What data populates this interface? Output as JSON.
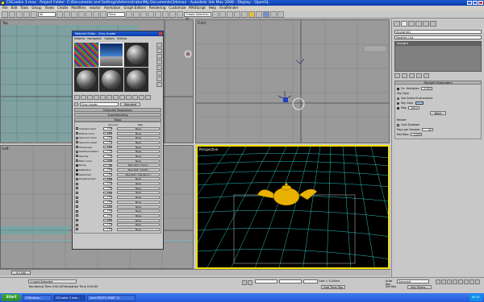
{
  "window": {
    "title": "CSCookie 3.max - Project Folder: C:\\Documents and Settings\\Administrator\\My Documents\\3dsmax - Autodesk 3ds Max 2008 - Display : OpenGL"
  },
  "menubar": [
    "File",
    "Edit",
    "Tools",
    "Group",
    "Views",
    "Create",
    "Modifiers",
    "reactor",
    "Animation",
    "Graph Editors",
    "Rendering",
    "Customize",
    "MAXScript",
    "Help",
    "FinalRender"
  ],
  "toolbar": {
    "selection_set": "All",
    "view_select": "View",
    "named_set": "Create Selection Se"
  },
  "viewports": {
    "top": "Top",
    "front": "Front",
    "left": "Left",
    "perspective": "Perspective"
  },
  "material_editor": {
    "title": "Material Editor - Grey shader",
    "menu": [
      "Material",
      "Navigation",
      "Options",
      "Utilities"
    ],
    "material_name": "Grey shader",
    "material_type": "Standard",
    "rollouts": [
      "Extended Parameters",
      "SuperSampling",
      "Maps"
    ],
    "columns": {
      "amount": "Amount",
      "map": "Map"
    },
    "maps": [
      {
        "name": "Ambient Color",
        "amount": "100",
        "map": "None",
        "on": false
      },
      {
        "name": "Diffuse Color",
        "amount": "100",
        "map": "None",
        "on": false
      },
      {
        "name": "Specular Color",
        "amount": "100",
        "map": "None",
        "on": false
      },
      {
        "name": "Specular Level",
        "amount": "100",
        "map": "None",
        "on": false
      },
      {
        "name": "Glossiness",
        "amount": "100",
        "map": "None",
        "on": false
      },
      {
        "name": "Self-Illumination",
        "amount": "100",
        "map": "None",
        "on": false
      },
      {
        "name": "Opacity",
        "amount": "100",
        "map": "None",
        "on": false
      },
      {
        "name": "Filter Color",
        "amount": "100",
        "map": "None",
        "on": false
      },
      {
        "name": "Bump",
        "amount": "30",
        "map": "Map #24 ( Hnoit )",
        "on": true
      },
      {
        "name": "Reflection",
        "amount": "100",
        "map": "Map #18 ( Falloff )",
        "on": true
      },
      {
        "name": "Refraction",
        "amount": "100",
        "map": "Map #23 ( Flat Mirror )",
        "on": true
      },
      {
        "name": "Displacement",
        "amount": "100",
        "map": "None",
        "on": false
      },
      {
        "name": "",
        "amount": "100",
        "map": "None",
        "on": false
      },
      {
        "name": "",
        "amount": "100",
        "map": "None",
        "on": false
      },
      {
        "name": "",
        "amount": "100",
        "map": "None",
        "on": false
      },
      {
        "name": "",
        "amount": "100",
        "map": "None",
        "on": false
      },
      {
        "name": "",
        "amount": "100",
        "map": "None",
        "on": false
      },
      {
        "name": "",
        "amount": "100",
        "map": "None",
        "on": false
      },
      {
        "name": "",
        "amount": "100",
        "map": "None",
        "on": false
      },
      {
        "name": "",
        "amount": "100",
        "map": "None",
        "on": false
      },
      {
        "name": "",
        "amount": "100",
        "map": "None",
        "on": false
      },
      {
        "name": "",
        "amount": "100",
        "map": "None",
        "on": false
      },
      {
        "name": "",
        "amount": "100",
        "map": "None",
        "on": false
      }
    ]
  },
  "command_panel": {
    "object_name": "Skylight01",
    "modifier_list": "Modifier List",
    "stack_item": "Skylight",
    "rollout_title": "Skylight Parameters",
    "on_label": "On",
    "multiplier_label": "Multiplier:",
    "multiplier_value": "0.325",
    "sky_color_label": "Sky Color",
    "use_scene_env": "Use Scene Environment",
    "sky_color_opt": "Sky Color",
    "map_label": "Map",
    "map_value": "100.0",
    "none_btn": "None",
    "render_label": "Render",
    "cast_shadows": "Cast Shadows",
    "rays_label": "Rays per Sample:",
    "rays_value": "20",
    "ray_bias_label": "Ray Bias:",
    "ray_bias_value": "0.005"
  },
  "timeline": {
    "slider": "0 / 100"
  },
  "status": {
    "selection": "1 Light Selected",
    "prompt": "Click or click-and-drag to select objects",
    "render_time": "Rendering Time 0:00:00",
    "translation_time": "Translation Time 0:00:00",
    "grid": "Grid = 0.254m",
    "add_time_tag": "Add Time Tag",
    "auto_key": "Auto Key",
    "set_key": "Set Key",
    "selected": "Selected",
    "key_filters": "Key Filters..."
  },
  "taskbar": {
    "start": "Start",
    "tasks": [
      "4 Windows...",
      "CSCookie 3.max...",
      "Corel PHOTO-PAINT 11"
    ],
    "clock": "00:47"
  }
}
